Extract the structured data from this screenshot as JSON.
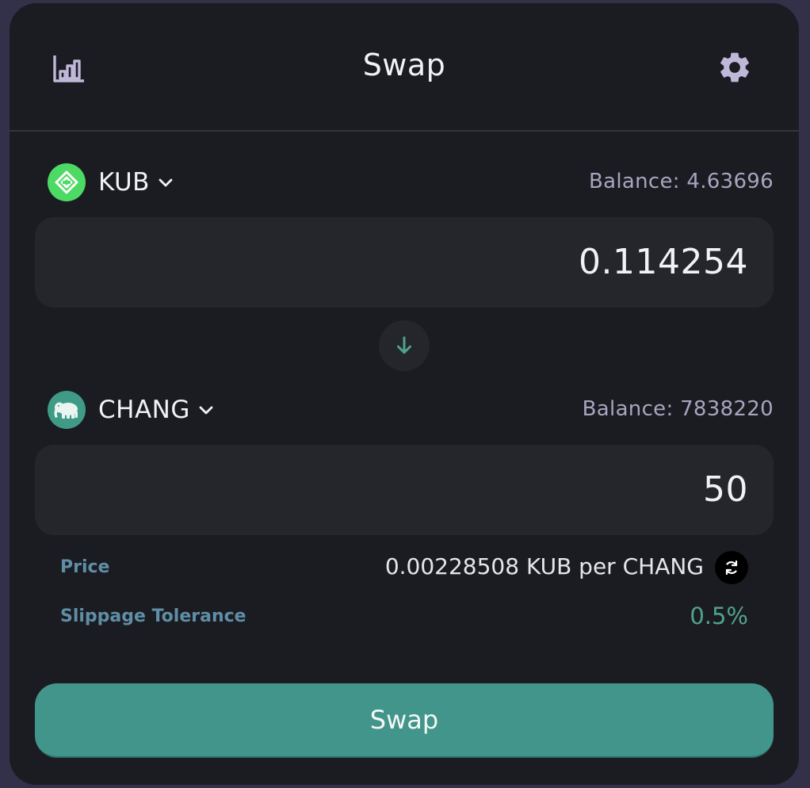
{
  "header": {
    "title": "Swap",
    "chart_icon": "bar-chart-icon",
    "settings_icon": "gear-icon"
  },
  "from": {
    "token": "KUB",
    "logo_icon": "kub-logo-icon",
    "logo_color": "#4cd964",
    "balance": "Balance: 4.63696",
    "amount": "0.114254"
  },
  "switch_icon": "arrow-down-icon",
  "to": {
    "token": "CHANG",
    "logo_icon": "elephant-logo-icon",
    "logo_color": "#3f9a86",
    "balance": "Balance: 7838220",
    "amount": "50"
  },
  "info": {
    "price_label": "Price",
    "price_value": "0.00228508 KUB per CHANG",
    "invert_icon": "refresh-icon",
    "slippage_label": "Slippage Tolerance",
    "slippage_value": "0.5%"
  },
  "swap_button": "Swap",
  "colors": {
    "background": "#33304a",
    "card": "#1b1c21",
    "input": "#25262c",
    "accent": "#41958a",
    "label": "#5f8ea6",
    "muted": "#a9a4bf"
  }
}
